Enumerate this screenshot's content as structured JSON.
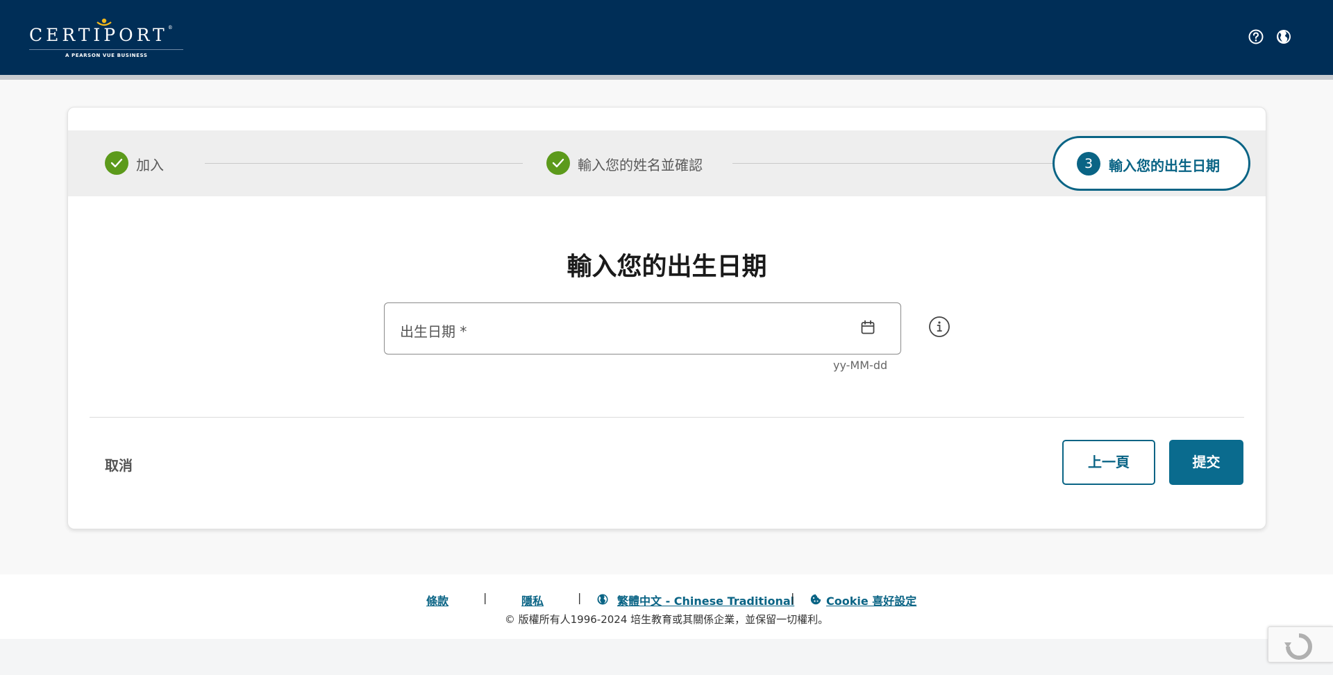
{
  "header": {
    "logo_text": "CERTIPORT",
    "logo_subtitle": "A PEARSON VUE BUSINESS",
    "help_icon": "help-circle-icon",
    "language_icon": "globe-icon"
  },
  "stepper": {
    "steps": [
      {
        "label": "加入",
        "status": "complete"
      },
      {
        "label": "輸入您的姓名並確認",
        "status": "complete"
      },
      {
        "number": "3",
        "label": "輸入您的出生日期",
        "status": "active"
      }
    ]
  },
  "form": {
    "title": "輸入您的出生日期",
    "date_field": {
      "label": "出生日期 *",
      "value": "",
      "hint": "yy-MM-dd"
    },
    "cancel_label": "取消",
    "previous_label": "上一頁",
    "submit_label": "提交"
  },
  "footer": {
    "links": [
      {
        "label": "條款"
      },
      {
        "label": "隱私"
      },
      {
        "label": "繁體中文 - Chinese Traditional",
        "icon": "globe-icon"
      },
      {
        "label": "Cookie 喜好設定",
        "icon": "cookie-icon"
      }
    ],
    "copyright": "© 版權所有人1996-2024 培生教育或其關係企業，並保留一切權利。"
  },
  "colors": {
    "header_bg": "#002e57",
    "accent": "#0a6485",
    "complete_green": "#5c9a1b",
    "submit_bg": "#0a6b8e"
  }
}
